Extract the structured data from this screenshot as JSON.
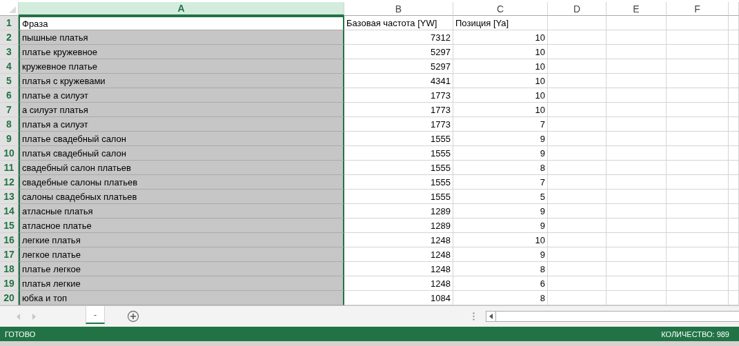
{
  "sheet": {
    "columns": [
      {
        "label": "A",
        "selected": true
      },
      {
        "label": "B",
        "selected": false
      },
      {
        "label": "C",
        "selected": false
      },
      {
        "label": "D",
        "selected": false
      },
      {
        "label": "E",
        "selected": false
      },
      {
        "label": "F",
        "selected": false
      }
    ],
    "rows": [
      {
        "number": "1",
        "active": true,
        "cells": [
          "Фраза",
          "Базовая частота [YW]",
          "Позиция [Ya]"
        ]
      },
      {
        "number": "2",
        "active": false,
        "cells": [
          "пышные платья",
          "7312",
          "10"
        ]
      },
      {
        "number": "3",
        "active": false,
        "cells": [
          "платье кружевное",
          "5297",
          "10"
        ]
      },
      {
        "number": "4",
        "active": false,
        "cells": [
          "кружевное платье",
          "5297",
          "10"
        ]
      },
      {
        "number": "5",
        "active": false,
        "cells": [
          "платья с кружевами",
          "4341",
          "10"
        ]
      },
      {
        "number": "6",
        "active": false,
        "cells": [
          "платье а силуэт",
          "1773",
          "10"
        ]
      },
      {
        "number": "7",
        "active": false,
        "cells": [
          "а силуэт платья",
          "1773",
          "10"
        ]
      },
      {
        "number": "8",
        "active": false,
        "cells": [
          "платья а силуэт",
          "1773",
          "7"
        ]
      },
      {
        "number": "9",
        "active": false,
        "cells": [
          "платье свадебный салон",
          "1555",
          "9"
        ]
      },
      {
        "number": "10",
        "active": false,
        "cells": [
          "платья свадебный салон",
          "1555",
          "9"
        ]
      },
      {
        "number": "11",
        "active": false,
        "cells": [
          "свадебный салон платьев",
          "1555",
          "8"
        ]
      },
      {
        "number": "12",
        "active": false,
        "cells": [
          "свадебные салоны платьев",
          "1555",
          "7"
        ]
      },
      {
        "number": "13",
        "active": false,
        "cells": [
          "салоны свадебных платьев",
          "1555",
          "5"
        ]
      },
      {
        "number": "14",
        "active": false,
        "cells": [
          "атласные платья",
          "1289",
          "9"
        ]
      },
      {
        "number": "15",
        "active": false,
        "cells": [
          "атласное платье",
          "1289",
          "9"
        ]
      },
      {
        "number": "16",
        "active": false,
        "cells": [
          "легкие платья",
          "1248",
          "10"
        ]
      },
      {
        "number": "17",
        "active": false,
        "cells": [
          "легкое платье",
          "1248",
          "9"
        ]
      },
      {
        "number": "18",
        "active": false,
        "cells": [
          "платье легкое",
          "1248",
          "8"
        ]
      },
      {
        "number": "19",
        "active": false,
        "cells": [
          "платья легкие",
          "1248",
          "6"
        ]
      },
      {
        "number": "20",
        "active": false,
        "cells": [
          "юбка и топ",
          "1084",
          "8"
        ]
      }
    ]
  },
  "sheet_tabs": [
    {
      "label": "-",
      "selected": true
    }
  ],
  "status_bar": {
    "mode": "ГОТОВО",
    "count": "КОЛИЧЕСТВО: 989"
  }
}
